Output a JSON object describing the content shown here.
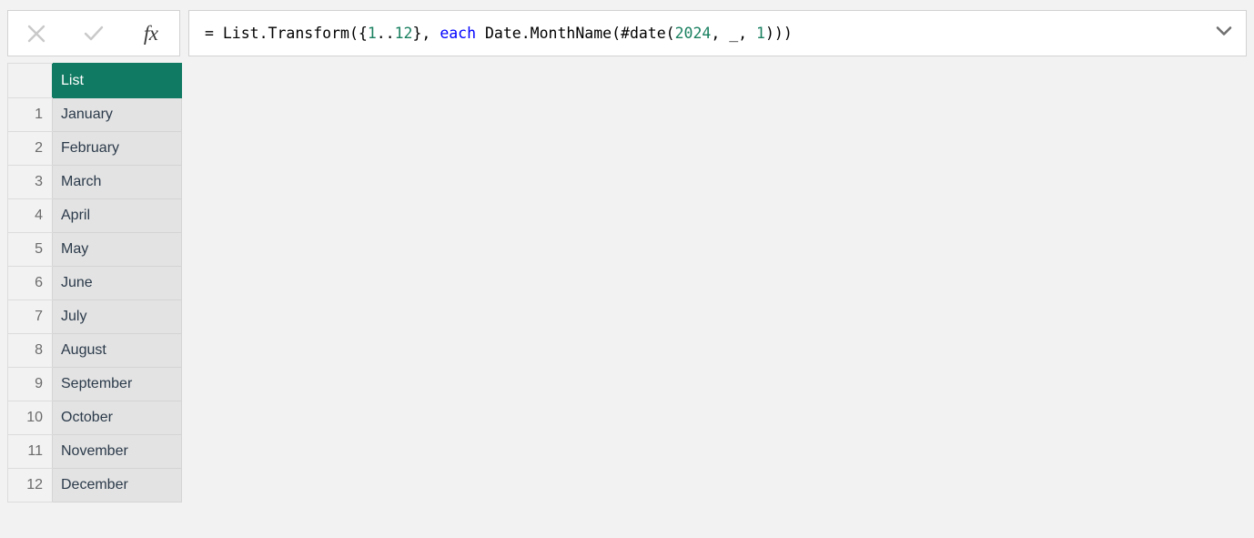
{
  "formula_bar": {
    "cancel_icon": "close-icon",
    "accept_icon": "check-icon",
    "fx_label": "fx",
    "dropdown_icon": "chevron-down-icon",
    "formula_full": "= List.Transform({1..12}, each Date.MonthName(#date(2024, _, 1)))",
    "tokens": [
      {
        "text": "= List.Transform({",
        "type": "plain"
      },
      {
        "text": "1",
        "type": "number"
      },
      {
        "text": "..",
        "type": "plain"
      },
      {
        "text": "12",
        "type": "number"
      },
      {
        "text": "}, ",
        "type": "plain"
      },
      {
        "text": "each",
        "type": "keyword"
      },
      {
        "text": " Date.MonthName(#date(",
        "type": "plain"
      },
      {
        "text": "2024",
        "type": "number"
      },
      {
        "text": ", _, ",
        "type": "plain"
      },
      {
        "text": "1",
        "type": "number"
      },
      {
        "text": ")))",
        "type": "plain"
      }
    ]
  },
  "result_table": {
    "header": "List",
    "index_header": "",
    "rows": [
      {
        "index": "1",
        "value": "January"
      },
      {
        "index": "2",
        "value": "February"
      },
      {
        "index": "3",
        "value": "March"
      },
      {
        "index": "4",
        "value": "April"
      },
      {
        "index": "5",
        "value": "May"
      },
      {
        "index": "6",
        "value": "June"
      },
      {
        "index": "7",
        "value": "July"
      },
      {
        "index": "8",
        "value": "August"
      },
      {
        "index": "9",
        "value": "September"
      },
      {
        "index": "10",
        "value": "October"
      },
      {
        "index": "11",
        "value": "November"
      },
      {
        "index": "12",
        "value": "December"
      }
    ]
  },
  "colors": {
    "header_teal": "#117a62",
    "keyword_blue": "#0000ff",
    "number_green": "#1a8060",
    "page_background": "#f2f2f2",
    "cell_background": "#e3e3e3"
  }
}
